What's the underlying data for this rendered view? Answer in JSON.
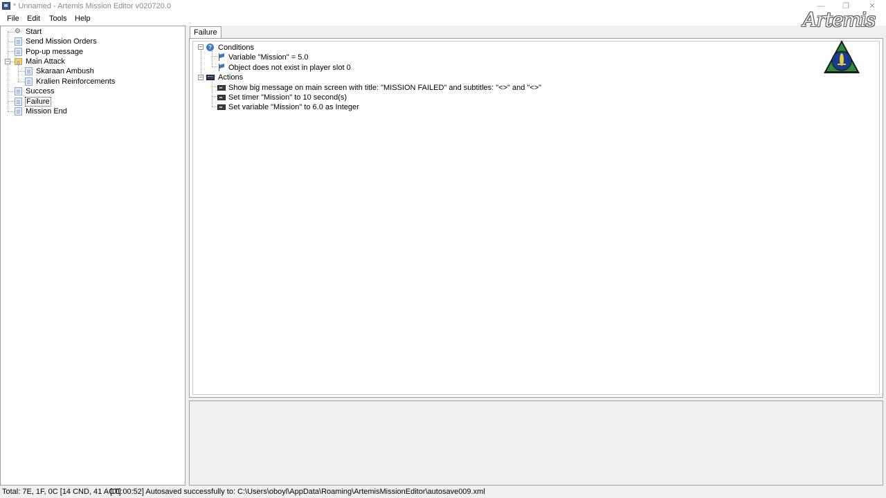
{
  "window": {
    "title": "* Unnamed - Artemis Mission Editor v020720.0",
    "minimize_glyph": "—",
    "restore_glyph": "❐",
    "close_glyph": "✕"
  },
  "menu": [
    "File",
    "Edit",
    "Tools",
    "Help"
  ],
  "tree": {
    "nodes": [
      {
        "label": "Start",
        "icon": "gear-icon"
      },
      {
        "label": "Send Mission Orders",
        "icon": "document-icon"
      },
      {
        "label": "Pop-up message",
        "icon": "document-icon"
      },
      {
        "label": "Main Attack",
        "icon": "folder-icon",
        "expanded": true
      },
      {
        "label": "Skaraan Ambush",
        "icon": "document-icon"
      },
      {
        "label": "Kralien Reinforcements",
        "icon": "document-icon"
      },
      {
        "label": "Success",
        "icon": "document-icon"
      },
      {
        "label": "Failure",
        "icon": "document-icon",
        "selected": true
      },
      {
        "label": "Mission End",
        "icon": "document-icon"
      }
    ]
  },
  "tab": {
    "label": "Failure"
  },
  "event": {
    "conditions_label": "Conditions",
    "conditions": [
      "Variable \"Mission\" = 5.0",
      "Object does not exist in player slot 0"
    ],
    "actions_label": "Actions",
    "actions": [
      "Show big message on main screen with title: \"MISSION FAILED\" and subtitles: \"<>\" and \"<>\"",
      "Set timer \"Mission\" to 10 second(s)",
      "Set variable \"Mission\" to 6.0 as Integer"
    ]
  },
  "logo": {
    "text": "Artemis",
    "colors": {
      "ring": "#2e8b3a",
      "inner": "#1a3a8a",
      "ship": "#e6c84a"
    }
  },
  "status": {
    "counts": "Total: 7E, 1F, 0C [14 CND, 41 ACT]",
    "message": "[01:00:52] Autosaved successfully to: C:\\Users\\oboyl\\AppData\\Roaming\\ArtemisMissionEditor\\autosave009.xml"
  },
  "colors": {
    "accent": "#3a79c9",
    "panel_border": "#a0a0a0",
    "background": "#f0f0f0"
  }
}
